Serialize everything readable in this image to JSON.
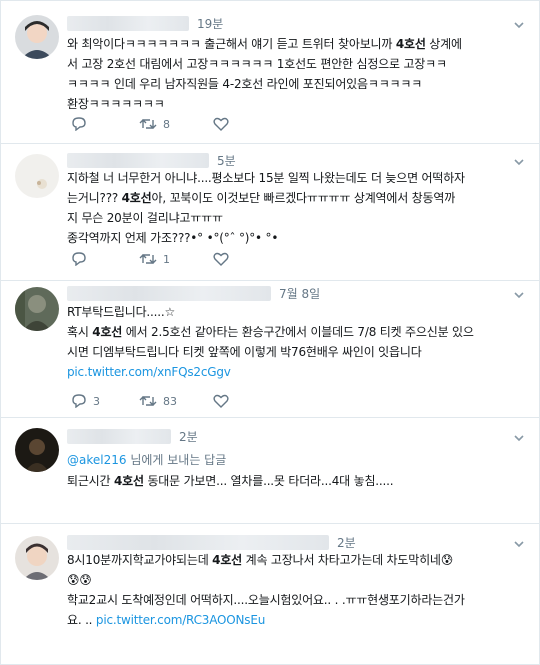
{
  "tweets": [
    {
      "time": "19분",
      "lines": [
        [
          "와 최악이다ㅋㅋㅋㅋㅋㅋㅋ 출근해서 얘기 듣고 트위터 찾아보니까 ",
          "4호선",
          " 상계에"
        ],
        [
          "서 고장 2호선 대림에서 고장ㅋㅋㅋㅋㅋㅋ 1호선도 편안한 심정으로 고장ㅋㅋ",
          "",
          ""
        ],
        [
          "ㅋㅋㅋㅋ 인데 우리 남자직원들 4-2호선 라인에 포진되어있음ㅋㅋㅋㅋㅋ",
          "",
          ""
        ],
        [
          "환장ㅋㅋㅋㅋㅋㅋㅋ",
          "",
          ""
        ]
      ],
      "retweets": "8",
      "replies": "",
      "likes": ""
    },
    {
      "time": "5분",
      "lines": [
        [
          "지하철 너 너무한거 아니냐....평소보다 15분 일찍 나왔는데도 더 늦으면 어떡하자",
          "",
          ""
        ],
        [
          "는거니??? ",
          "4호선",
          "아, 꼬북이도 이것보단 빠르겠다ㅠㅠㅠㅠ 상계역에서 창동역까"
        ],
        [
          "지 무슨 20분이 걸리냐고ㅠㅠㅠ",
          "",
          ""
        ],
        [
          "종각역까지 언제 가조???•° •°(°ˆ °)°• °•",
          "",
          ""
        ]
      ],
      "retweets": "1",
      "replies": "",
      "likes": ""
    },
    {
      "time": "7월 8일",
      "name_prefix": "RT부탁드립니다.....☆",
      "lines": [
        [
          "혹시 ",
          "4호선",
          " 에서 2.5호선 같아타는 환승구간에서 이블데드 7/8 티켓 주으신분 있으"
        ],
        [
          "시면 디엠부탁드립니다 티켓 앞쪽에 이렇게 박76현배우 싸인이 잇읍니다",
          "",
          ""
        ]
      ],
      "link": "pic.twitter.com/xnFQs2cGgv",
      "replies": "3",
      "retweets": "83",
      "likes": ""
    },
    {
      "time": "2분",
      "reply_handle": "@akel216",
      "reply_suffix": " 님에게 보내는 답글",
      "lines": [
        [
          "퇴근시간 ",
          "4호선",
          " 동대문 가보면... 열차를...못 타더라...4대 놓침....."
        ]
      ],
      "replies": "",
      "retweets": "",
      "likes": ""
    },
    {
      "time": "2분",
      "lines": [
        [
          "8시10분까지학교가야되는데 ",
          "4호선",
          " 계속 고장나서 차타고가는데 차도막히네😰"
        ],
        [
          "😰😰",
          "",
          ""
        ],
        [
          "학교2교시 도착예정인데 어떡하지....오늘시험있어요.. . .ㅠㅠ현생포기하라는건가",
          "",
          ""
        ]
      ],
      "link_prefix": "요.  .. ",
      "link": "pic.twitter.com/RC3AOONsEu",
      "replies": "",
      "retweets": "",
      "likes": ""
    }
  ],
  "colors": {
    "link": "#1b95e0",
    "meta": "#657786",
    "border": "#e1e8ed"
  },
  "icons": [
    "reply-icon",
    "retweet-icon",
    "like-icon",
    "caret-down-icon",
    "avatar"
  ]
}
